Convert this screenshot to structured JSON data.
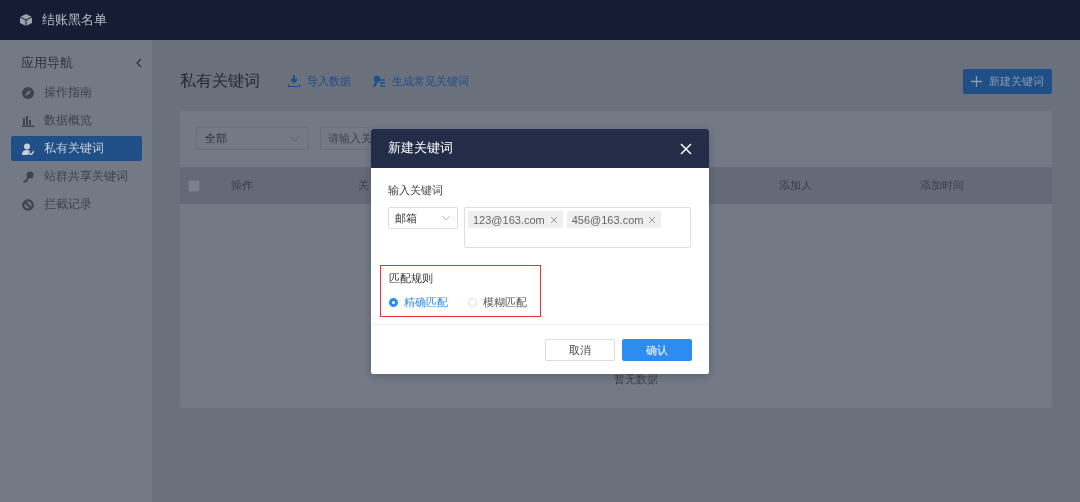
{
  "app": {
    "title": "结账黑名单"
  },
  "sidebar": {
    "heading": "应用导航",
    "items": [
      {
        "label": "操作指南",
        "selected": false
      },
      {
        "label": "数据概览",
        "selected": false
      },
      {
        "label": "私有关键词",
        "selected": true
      },
      {
        "label": "站群共享关键词",
        "selected": false
      },
      {
        "label": "拦截记录",
        "selected": false
      }
    ]
  },
  "page": {
    "title": "私有关键词",
    "actions": [
      "导入数据",
      "生成常见关键词"
    ],
    "new_button": "新建关键词"
  },
  "filters": {
    "category": "全部",
    "search_placeholder": "请输入关"
  },
  "table": {
    "select_all_checked": false,
    "columns": [
      "操作",
      "关",
      "添加人",
      "添加时间"
    ],
    "empty_text": "暂无数据"
  },
  "dialog": {
    "title": "新建关键词",
    "field_label": "输入关键词",
    "type_select": "邮箱",
    "tags": [
      "123@163.com",
      "456@163.com"
    ],
    "match_label": "匹配规则",
    "match_highlighted": true,
    "match_options": [
      {
        "label": "精确匹配",
        "selected": true
      },
      {
        "label": "模糊匹配",
        "selected": false
      }
    ],
    "buttons": [
      {
        "label": "取消",
        "kind": "secondary"
      },
      {
        "label": "确认",
        "kind": "primary"
      }
    ]
  }
}
